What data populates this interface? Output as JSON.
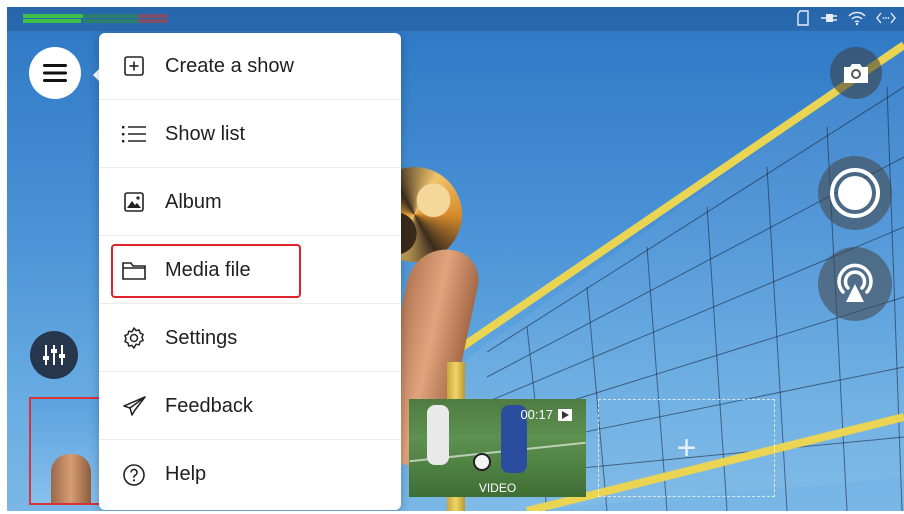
{
  "status_bar": {
    "icons": [
      "sd-card-icon",
      "plug-icon",
      "wifi-icon",
      "code-icon"
    ]
  },
  "menu": {
    "items": [
      {
        "label": "Create a show",
        "icon": "plus-square-icon"
      },
      {
        "label": "Show list",
        "icon": "list-icon"
      },
      {
        "label": "Album",
        "icon": "image-icon"
      },
      {
        "label": "Media file",
        "icon": "folder-icon",
        "highlighted": true
      },
      {
        "label": "Settings",
        "icon": "gear-icon"
      },
      {
        "label": "Feedback",
        "icon": "send-icon"
      },
      {
        "label": "Help",
        "icon": "help-circle-icon"
      }
    ]
  },
  "thumbnails": {
    "video": {
      "duration": "00:17",
      "type_label": "VIDEO"
    },
    "add_label": "+"
  },
  "colors": {
    "highlight": "#e0232b",
    "selected_thumb_border": "#d8323a",
    "mixer_button": "#26364d"
  }
}
